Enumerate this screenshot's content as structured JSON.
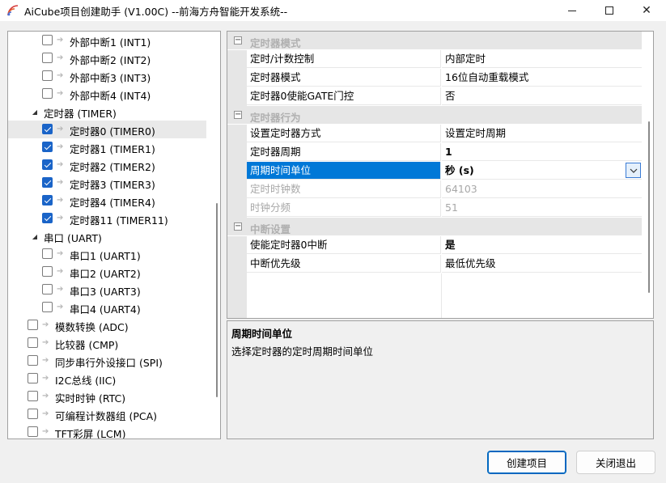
{
  "window": {
    "title": "AiCube项目创建助手 (V1.00C) --前海方舟智能开发系统--",
    "controls": {
      "minimize": "minimize-icon",
      "maximize": "maximize-icon",
      "close": "✕"
    }
  },
  "tree": {
    "items": [
      {
        "label": "外部中断1 (INT1)",
        "level": 2,
        "checked": false
      },
      {
        "label": "外部中断2 (INT2)",
        "level": 2,
        "checked": false
      },
      {
        "label": "外部中断3 (INT3)",
        "level": 2,
        "checked": false
      },
      {
        "label": "外部中断4 (INT4)",
        "level": 2,
        "checked": false
      },
      {
        "label": "定时器 (TIMER)",
        "level": 1,
        "expander": true
      },
      {
        "label": "定时器0 (TIMER0)",
        "level": 2,
        "checked": true,
        "selected": true
      },
      {
        "label": "定时器1 (TIMER1)",
        "level": 2,
        "checked": true
      },
      {
        "label": "定时器2 (TIMER2)",
        "level": 2,
        "checked": true
      },
      {
        "label": "定时器3 (TIMER3)",
        "level": 2,
        "checked": true
      },
      {
        "label": "定时器4 (TIMER4)",
        "level": 2,
        "checked": true
      },
      {
        "label": "定时器11 (TIMER11)",
        "level": 2,
        "checked": true
      },
      {
        "label": "串口 (UART)",
        "level": 1,
        "expander": true
      },
      {
        "label": "串口1 (UART1)",
        "level": 2,
        "checked": false
      },
      {
        "label": "串口2 (UART2)",
        "level": 2,
        "checked": false
      },
      {
        "label": "串口3 (UART3)",
        "level": 2,
        "checked": false
      },
      {
        "label": "串口4 (UART4)",
        "level": 2,
        "checked": false
      },
      {
        "label": "模数转换 (ADC)",
        "level": 0,
        "checked": false
      },
      {
        "label": "比较器 (CMP)",
        "level": 0,
        "checked": false
      },
      {
        "label": "同步串行外设接口 (SPI)",
        "level": 0,
        "checked": false
      },
      {
        "label": "I2C总线 (IIC)",
        "level": 0,
        "checked": false
      },
      {
        "label": "实时时钟 (RTC)",
        "level": 0,
        "checked": false
      },
      {
        "label": "可编程计数器组 (PCA)",
        "level": 0,
        "checked": false
      },
      {
        "label": "TFT彩屏 (LCM)",
        "level": 0,
        "checked": false
      }
    ]
  },
  "property_grid": {
    "rows": [
      {
        "type": "category",
        "label": "定时器模式",
        "toggle": "⊟"
      },
      {
        "type": "prop",
        "name": "定时/计数控制",
        "value": "内部定时"
      },
      {
        "type": "prop",
        "name": "定时器模式",
        "value": "16位自动重载模式"
      },
      {
        "type": "prop",
        "name": "定时器0使能GATE门控",
        "value": "否"
      },
      {
        "type": "category",
        "label": "定时器行为",
        "toggle": "⊟"
      },
      {
        "type": "prop",
        "name": "设置定时器方式",
        "value": "设置定时周期"
      },
      {
        "type": "prop",
        "name": "定时器周期",
        "value": "1",
        "bold": true
      },
      {
        "type": "prop",
        "name": "周期时间单位",
        "value": "秒 (s)",
        "selected": true,
        "dropdown": true
      },
      {
        "type": "prop",
        "name": "定时时钟数",
        "value": "64103",
        "disabled": true
      },
      {
        "type": "prop",
        "name": "时钟分频",
        "value": "51",
        "disabled": true
      },
      {
        "type": "category",
        "label": "中断设置",
        "toggle": "⊟"
      },
      {
        "type": "prop",
        "name": "使能定时器0中断",
        "value": "是",
        "bold": true
      },
      {
        "type": "prop",
        "name": "中断优先级",
        "value": "最低优先级"
      }
    ]
  },
  "description": {
    "title": "周期时间单位",
    "text": "选择定时器的定时周期时间单位"
  },
  "buttons": {
    "create": "创建项目",
    "exit": "关闭退出"
  },
  "colors": {
    "selection": "#0078d7",
    "checkbox": "#1a64c8",
    "category_bg": "#e6e6e6"
  }
}
